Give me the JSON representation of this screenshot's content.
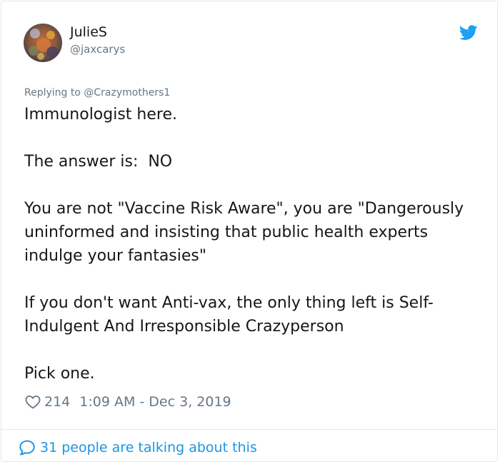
{
  "user": {
    "display_name": "JulieS",
    "handle": "@jaxcarys",
    "avatar_icon": "avatar-photo"
  },
  "brand": {
    "icon": "twitter-bird-icon",
    "color": "#1da1f2"
  },
  "reply": {
    "prefix": "Replying to ",
    "to": "@Crazymothers1"
  },
  "tweet": {
    "paragraphs": [
      "Immunologist here.",
      "The answer is:  NO",
      "You are not \"Vaccine Risk Aware\", you are \"Dangerously uninformed and insisting that public health experts indulge your fantasies\"",
      "If you don't want Anti-vax, the only thing left is Self-Indulgent And Irresponsible Crazyperson",
      "Pick one."
    ]
  },
  "meta": {
    "likes": "214",
    "timestamp": "1:09 AM - Dec 3, 2019",
    "heart_icon": "heart-outline-icon"
  },
  "footer": {
    "talking_text": "31 people are talking about this",
    "bubble_icon": "comment-bubble-icon",
    "link_color": "#1b95e0"
  },
  "colors": {
    "text": "#14171a",
    "secondary": "#657786",
    "border": "#e1e8ed"
  }
}
